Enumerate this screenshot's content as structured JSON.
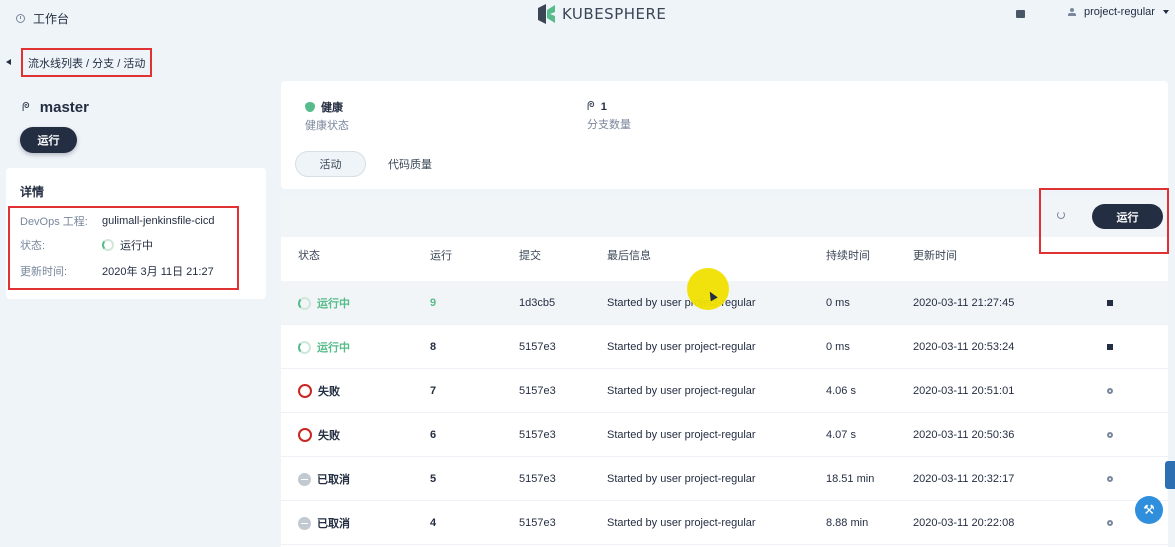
{
  "topbar": {
    "workbench_label": "工作台",
    "logo_text": "KUBESPHERE",
    "user_name": "project-regular"
  },
  "breadcrumb": {
    "text": "流水线列表 / 分支 / 活动"
  },
  "branch": {
    "name": "master",
    "run_label": "运行"
  },
  "details": {
    "title": "详情",
    "rows": [
      {
        "key": "DevOps 工程:",
        "value": "gulimall-jenkinsfile-cicd"
      },
      {
        "key": "状态:",
        "value": "运行中"
      },
      {
        "key": "更新时间:",
        "value": "2020年 3月 11日 21:27"
      }
    ]
  },
  "stats": {
    "health_value": "健康",
    "health_label": "健康状态",
    "branch_count": "1",
    "branch_count_label": "分支数量"
  },
  "tabs": [
    {
      "label": "活动",
      "active": true
    },
    {
      "label": "代码质量",
      "active": false
    }
  ],
  "toolbar": {
    "run_label": "运行"
  },
  "table": {
    "headers": [
      "状态",
      "运行",
      "提交",
      "最后信息",
      "持续时间",
      "更新时间"
    ],
    "rows": [
      {
        "status": "运行中",
        "status_type": "running",
        "run": "9",
        "commit": "1d3cb5",
        "message": "Started by user project-regular",
        "duration": "0 ms",
        "updated": "2020-03-11 21:27:45",
        "action_icon": "stop-icon"
      },
      {
        "status": "运行中",
        "status_type": "running",
        "run": "8",
        "commit": "5157e3",
        "message": "Started by user project-regular",
        "duration": "0 ms",
        "updated": "2020-03-11 20:53:24",
        "action_icon": "stop-icon"
      },
      {
        "status": "失败",
        "status_type": "failed",
        "run": "7",
        "commit": "5157e3",
        "message": "Started by user project-regular",
        "duration": "4.06 s",
        "updated": "2020-03-11 20:51:01",
        "action_icon": "rerun-icon"
      },
      {
        "status": "失败",
        "status_type": "failed",
        "run": "6",
        "commit": "5157e3",
        "message": "Started by user project-regular",
        "duration": "4.07 s",
        "updated": "2020-03-11 20:50:36",
        "action_icon": "rerun-icon"
      },
      {
        "status": "已取消",
        "status_type": "cancelled",
        "run": "5",
        "commit": "5157e3",
        "message": "Started by user project-regular",
        "duration": "18.51 min",
        "updated": "2020-03-11 20:32:17",
        "action_icon": "rerun-icon"
      },
      {
        "status": "已取消",
        "status_type": "cancelled",
        "run": "4",
        "commit": "5157e3",
        "message": "Started by user project-regular",
        "duration": "8.88 min",
        "updated": "2020-03-11 20:22:08",
        "action_icon": "rerun-icon"
      }
    ]
  },
  "colors": {
    "running": "#55bc8a",
    "failed": "#ca2621",
    "cancelled": "#c1c9d1",
    "primary_dark": "#242e42",
    "annotation_red": "#e03232"
  }
}
